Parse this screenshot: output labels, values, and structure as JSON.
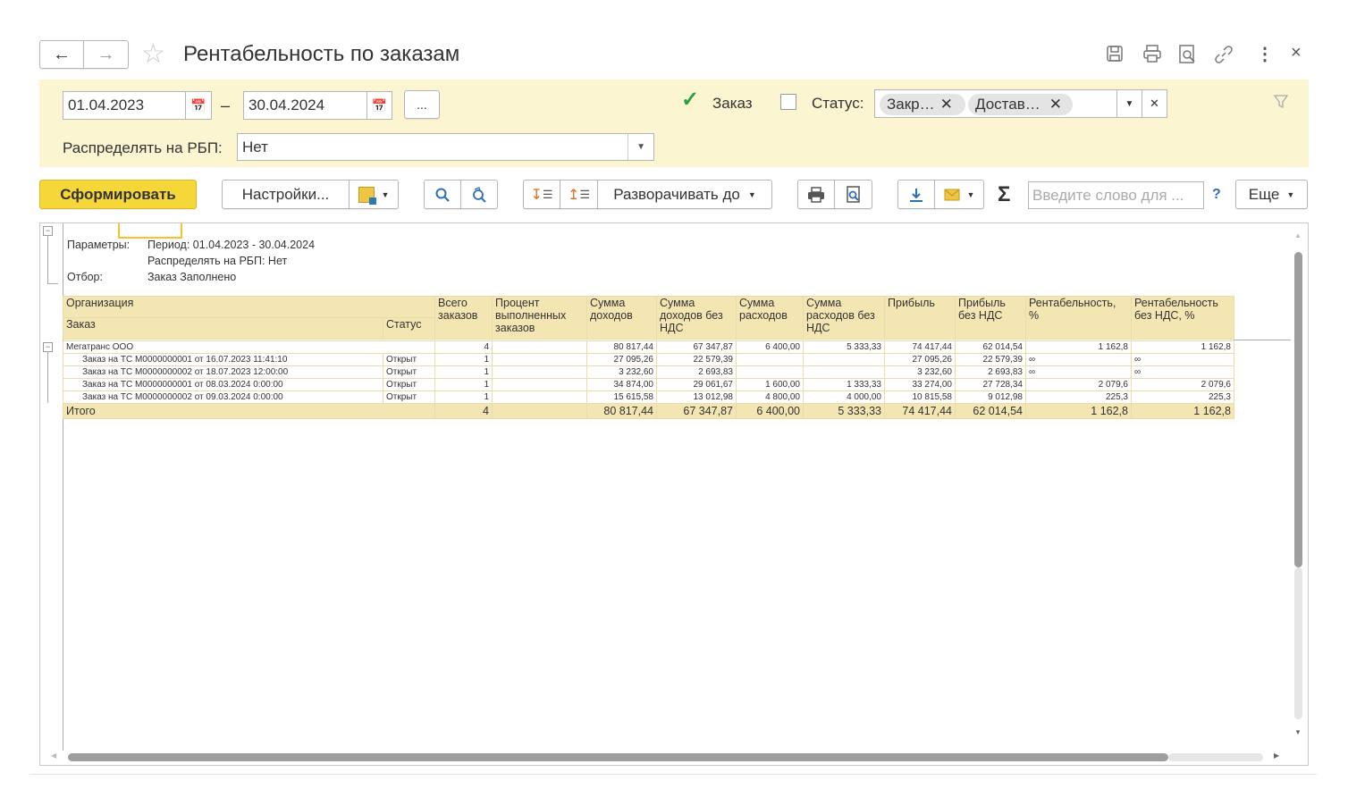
{
  "header": {
    "title": "Рентабельность по заказам"
  },
  "filters": {
    "date_from": "01.04.2023",
    "date_dash": "–",
    "date_to": "30.04.2024",
    "period_btn": "...",
    "order_label": "Заказ",
    "order_checked": true,
    "status_label": "Статус:",
    "status_checked": false,
    "status_chips": [
      "Закр…",
      "Достав…"
    ],
    "distribute_label": "Распределять на РБП:",
    "distribute_value": "Нет"
  },
  "toolbar": {
    "generate": "Сформировать",
    "settings": "Настройки...",
    "expand_to": "Разворачивать до",
    "search_placeholder": "Введите слово для ...",
    "help": "?",
    "more": "Еще",
    "sigma": "Σ"
  },
  "report": {
    "params_label": "Параметры:",
    "period_text": "Период: 01.04.2023 - 30.04.2024",
    "distribute_text": "Распределять на РБП: Нет",
    "filter_label": "Отбор:",
    "filter_text": "Заказ Заполнено",
    "columns": {
      "org": "Организация",
      "order": "Заказ",
      "status": "Статус",
      "total_orders": "Всего заказов",
      "percent_done": "Процент выполненных заказов",
      "income": "Сумма доходов",
      "income_no_vat": "Сумма доходов без НДС",
      "expense": "Сумма расходов",
      "expense_no_vat": "Сумма расходов без НДС",
      "profit": "Прибыль",
      "profit_no_vat": "Прибыль без НДС",
      "rent": "Рентабельность, %",
      "rent_no_vat": "Рентабельность без НДС, %"
    },
    "group": {
      "name": "Мегатранс ООО",
      "total_orders": "4",
      "percent_done": "",
      "income": "80 817,44",
      "income_no_vat": "67 347,87",
      "expense": "6 400,00",
      "expense_no_vat": "5 333,33",
      "profit": "74 417,44",
      "profit_no_vat": "62 014,54",
      "rent": "1 162,8",
      "rent_no_vat": "1 162,8"
    },
    "rows": [
      {
        "order": "Заказ на ТС М0000000001 от 16.07.2023 11:41:10",
        "status": "Открыт",
        "total": "1",
        "income": "27 095,26",
        "income_nv": "22 579,39",
        "expense": "",
        "expense_nv": "",
        "profit": "27 095,26",
        "profit_nv": "22 579,39",
        "rent": "∞",
        "rent_nv": "∞"
      },
      {
        "order": "Заказ на ТС М0000000002 от 18.07.2023 12:00:00",
        "status": "Открыт",
        "total": "1",
        "income": "3 232,60",
        "income_nv": "2 693,83",
        "expense": "",
        "expense_nv": "",
        "profit": "3 232,60",
        "profit_nv": "2 693,83",
        "rent": "∞",
        "rent_nv": "∞"
      },
      {
        "order": "Заказ на ТС М0000000001 от 08.03.2024 0:00:00",
        "status": "Открыт",
        "total": "1",
        "income": "34 874,00",
        "income_nv": "29 061,67",
        "expense": "1 600,00",
        "expense_nv": "1 333,33",
        "profit": "33 274,00",
        "profit_nv": "27 728,34",
        "rent": "2 079,6",
        "rent_nv": "2 079,6"
      },
      {
        "order": "Заказ на ТС М0000000002 от 09.03.2024 0:00:00",
        "status": "Открыт",
        "total": "1",
        "income": "15 615,58",
        "income_nv": "13 012,98",
        "expense": "4 800,00",
        "expense_nv": "4 000,00",
        "profit": "10 815,58",
        "profit_nv": "9 012,98",
        "rent": "225,3",
        "rent_nv": "225,3"
      }
    ],
    "total": {
      "label": "Итого",
      "total_orders": "4",
      "income": "80 817,44",
      "income_no_vat": "67 347,87",
      "expense": "6 400,00",
      "expense_no_vat": "5 333,33",
      "profit": "74 417,44",
      "profit_no_vat": "62 014,54",
      "rent": "1 162,8",
      "rent_no_vat": "1 162,8"
    }
  },
  "colors": {
    "accent_yellow": "#f5d73a",
    "panel_bg": "#fbf5d2",
    "header_bg": "#f3e6b3",
    "check_green": "#2e9e3e"
  }
}
